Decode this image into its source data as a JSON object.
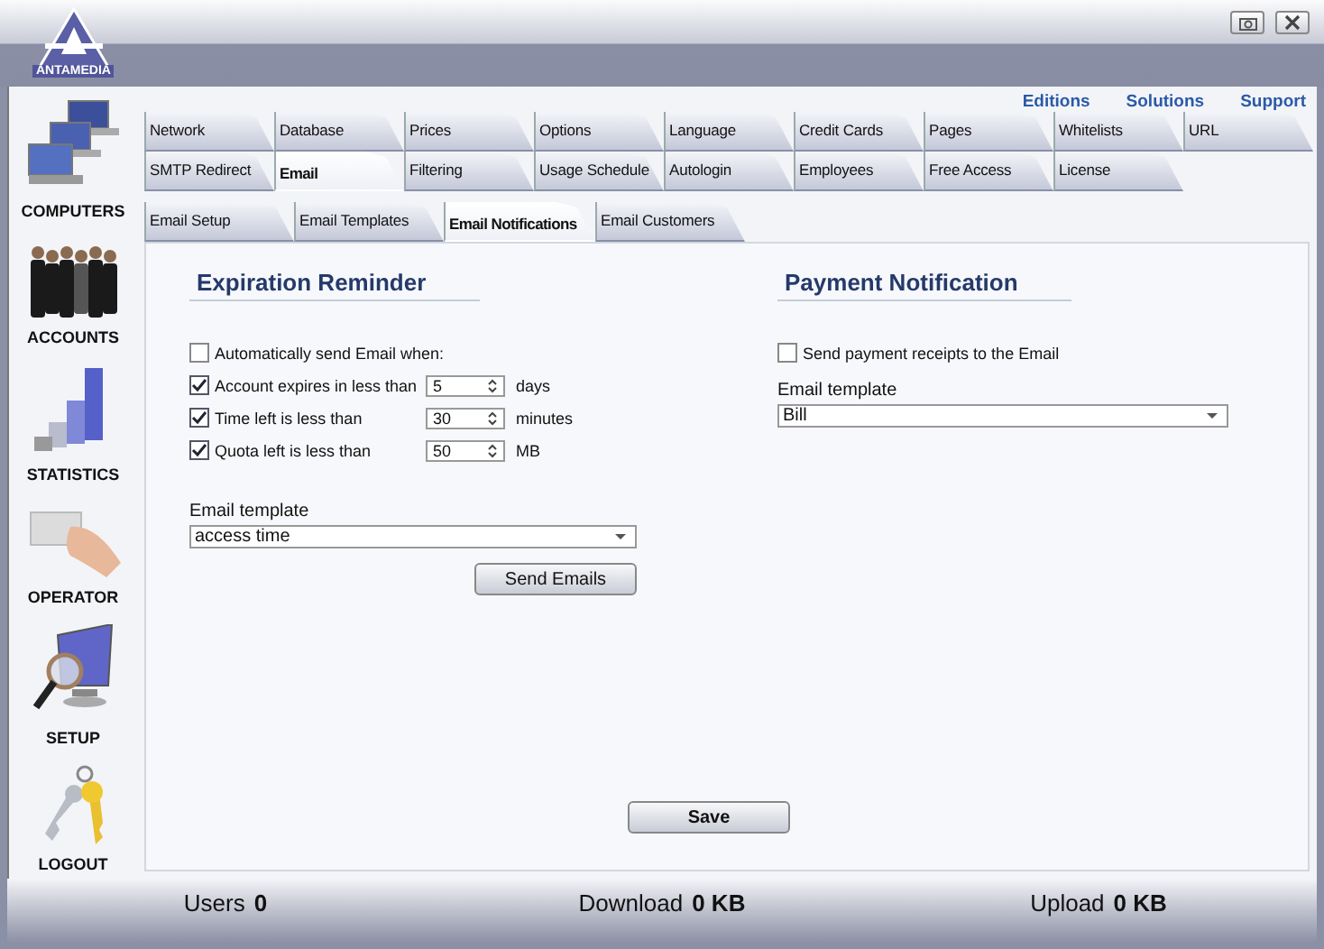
{
  "window": {
    "logo": "ANTAMEDIA",
    "buttons": [
      {
        "kind": "camera"
      },
      {
        "kind": "close"
      }
    ]
  },
  "header_links": [
    "Editions",
    "Solutions",
    "Support"
  ],
  "sidebar": {
    "items": [
      {
        "label": "COMPUTERS",
        "kind": "computers"
      },
      {
        "label": "ACCOUNTS",
        "kind": "people"
      },
      {
        "label": "STATISTICS",
        "kind": "chart"
      },
      {
        "label": "OPERATOR",
        "kind": "card"
      },
      {
        "label": "SETUP",
        "kind": "monitor"
      },
      {
        "label": "LOGOUT",
        "kind": "keys"
      }
    ]
  },
  "tabs_row_1": [
    {
      "label": "Network",
      "selected": false
    },
    {
      "label": "Database",
      "selected": false
    },
    {
      "label": "Prices",
      "selected": false
    },
    {
      "label": "Options",
      "selected": false
    },
    {
      "label": "Language",
      "selected": false
    },
    {
      "label": "Credit Cards",
      "selected": false
    },
    {
      "label": "Pages",
      "selected": false
    },
    {
      "label": "Whitelists",
      "selected": false
    },
    {
      "label": "URL",
      "selected": false
    }
  ],
  "tabs_row_2": [
    {
      "label": "SMTP Redirect",
      "selected": false
    },
    {
      "label": "Email",
      "selected": true
    },
    {
      "label": "Filtering",
      "selected": false
    },
    {
      "label": "Usage Schedule",
      "selected": false
    },
    {
      "label": "Autologin",
      "selected": false
    },
    {
      "label": "Employees",
      "selected": false
    },
    {
      "label": "Free Access",
      "selected": false
    },
    {
      "label": "License",
      "selected": false
    }
  ],
  "subtabs": [
    {
      "label": "Email Setup",
      "selected": false
    },
    {
      "label": "Email Templates",
      "selected": false
    },
    {
      "label": "Email Notifications",
      "selected": true
    },
    {
      "label": "Email Customers",
      "selected": false
    }
  ],
  "expiration_reminder": {
    "title": "Expiration Reminder",
    "options": [
      {
        "kind": "checkbox",
        "label": "Automatically send Email when:",
        "checked": false
      },
      {
        "kind": "threshold",
        "label": "Account expires in less than",
        "checked": true,
        "value": "5",
        "unit": "days"
      },
      {
        "kind": "threshold",
        "label": "Time left is less than",
        "checked": true,
        "value": "30",
        "unit": "minutes"
      },
      {
        "kind": "threshold",
        "label": "Quota left is less than",
        "checked": true,
        "value": "50",
        "unit": "MB"
      }
    ],
    "template_label": "Email template",
    "template_value": "access time",
    "send_button": "Send Emails"
  },
  "payment_notification": {
    "title": "Payment Notification",
    "option": {
      "label": "Send payment receipts to the Email",
      "checked": false
    },
    "template_label": "Email template",
    "template_value": "Bill"
  },
  "save_button": "Save",
  "status_bar": [
    {
      "label": "Users",
      "value": "0"
    },
    {
      "label": "Download",
      "value": "0 KB"
    },
    {
      "label": "Upload",
      "value": "0 KB"
    }
  ]
}
